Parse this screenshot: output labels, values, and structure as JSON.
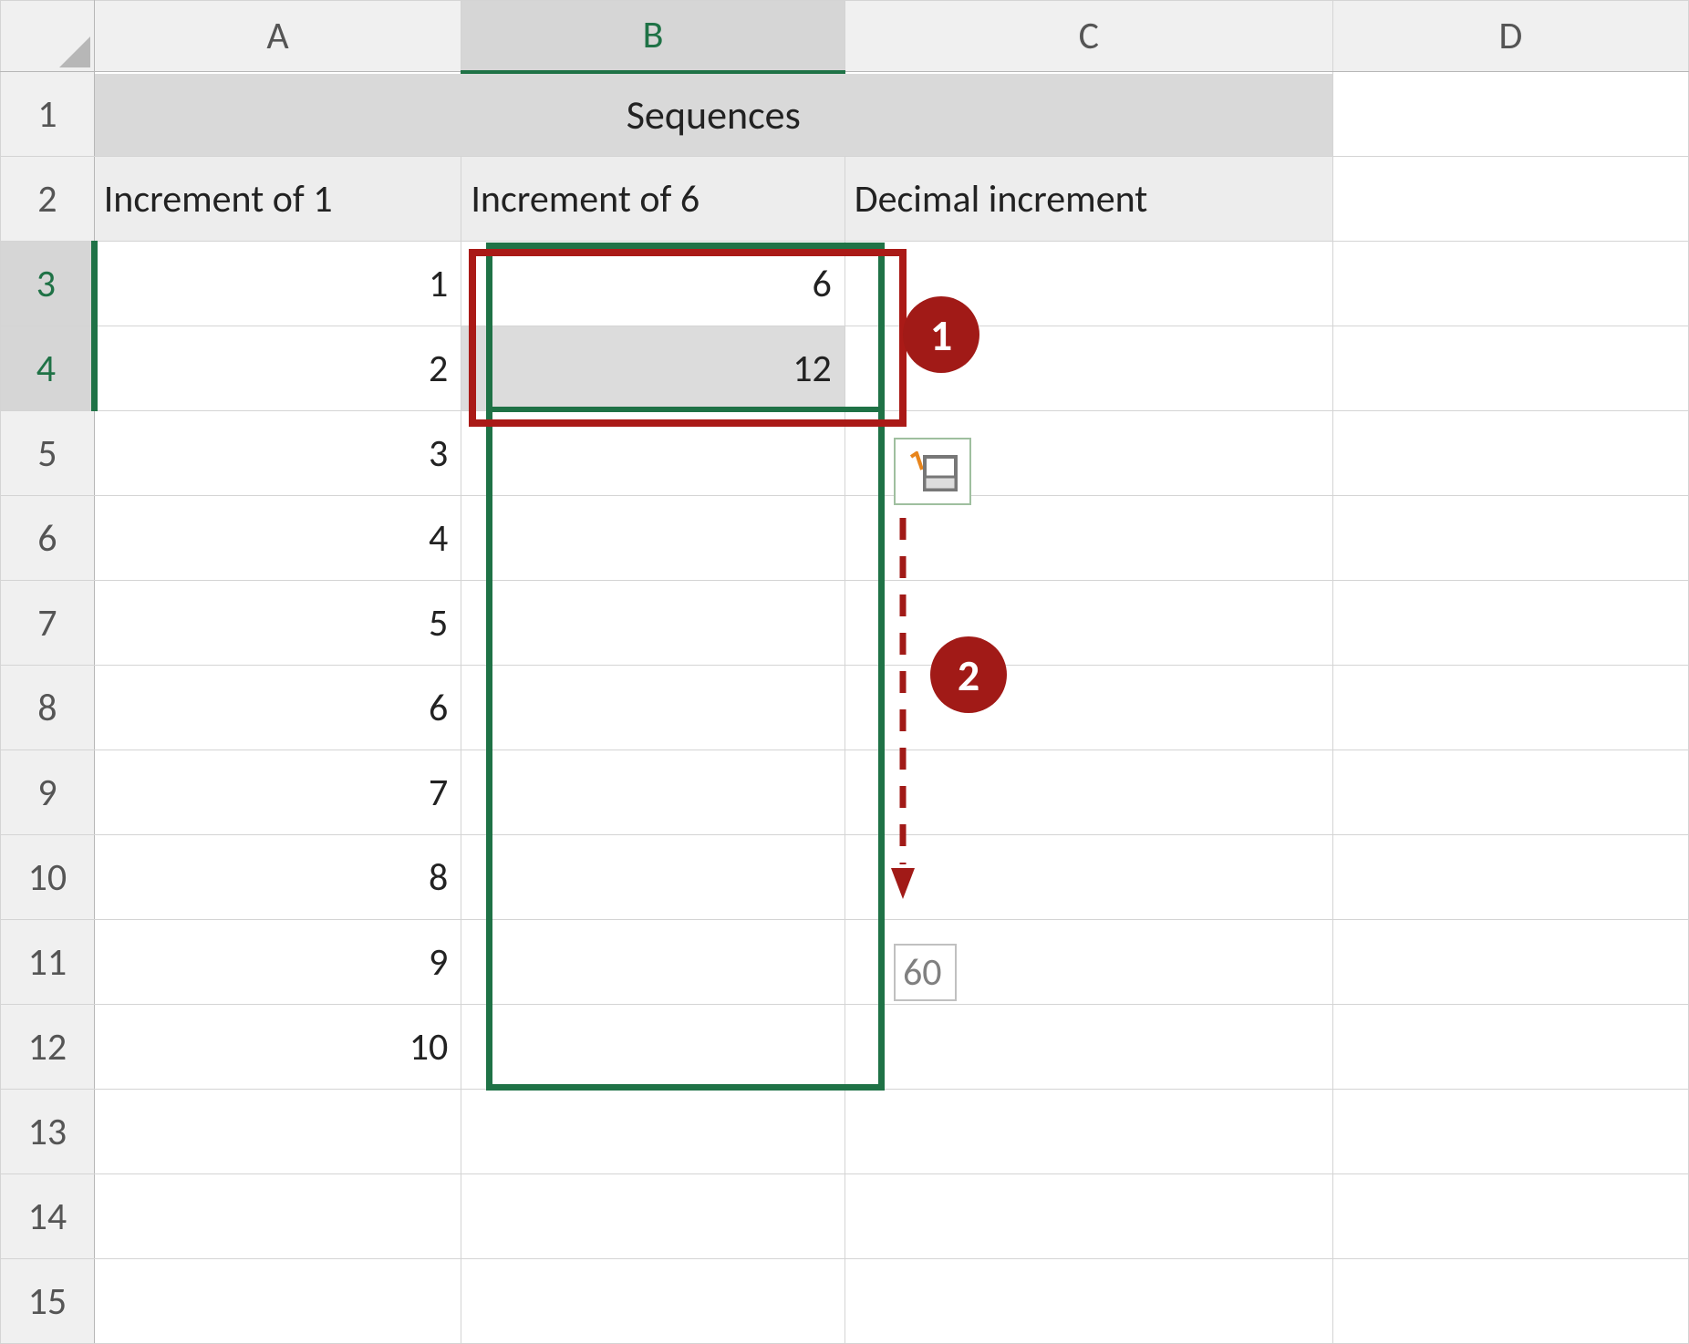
{
  "colors": {
    "selection_green": "#1f7246",
    "annotation_red": "#a11a17",
    "header_gray": "#f0f0f0"
  },
  "columns": [
    "A",
    "B",
    "C",
    "D"
  ],
  "rows": [
    "1",
    "2",
    "3",
    "4",
    "5",
    "6",
    "7",
    "8",
    "9",
    "10",
    "11",
    "12",
    "13",
    "14",
    "15"
  ],
  "title": "Sequences",
  "subheaders": {
    "A": "Increment of 1",
    "B": "Increment of 6",
    "C": "Decimal increment"
  },
  "colA_values": [
    "1",
    "2",
    "3",
    "4",
    "5",
    "6",
    "7",
    "8",
    "9",
    "10"
  ],
  "colB_values": [
    "6",
    "12"
  ],
  "drag_tooltip": "60",
  "annotations": {
    "step1": "1",
    "step2": "2"
  },
  "icons": {
    "quick_analysis": "quick-analysis-icon"
  },
  "selected_column": "B",
  "selected_rows_start": 3,
  "selected_rows_end": 4,
  "drag_range_end_row": 12
}
